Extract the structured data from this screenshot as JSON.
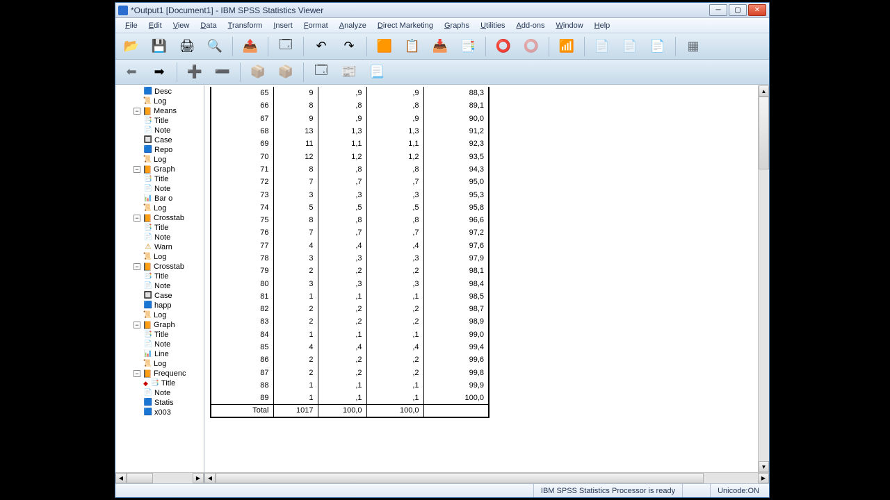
{
  "title": "*Output1 [Document1] - IBM SPSS Statistics Viewer",
  "menu": [
    "File",
    "Edit",
    "View",
    "Data",
    "Transform",
    "Insert",
    "Format",
    "Analyze",
    "Direct Marketing",
    "Graphs",
    "Utilities",
    "Add-ons",
    "Window",
    "Help"
  ],
  "outline": [
    {
      "ind": 3,
      "icon": "table",
      "label": "Desc"
    },
    {
      "ind": 2,
      "icon": "log",
      "label": "Log"
    },
    {
      "ind": 2,
      "icon": "book",
      "label": "Means",
      "exp": "−"
    },
    {
      "ind": 3,
      "icon": "title",
      "label": "Title"
    },
    {
      "ind": 3,
      "icon": "note",
      "label": "Note"
    },
    {
      "ind": 3,
      "icon": "case",
      "label": "Case"
    },
    {
      "ind": 3,
      "icon": "table",
      "label": "Repo"
    },
    {
      "ind": 2,
      "icon": "log",
      "label": "Log"
    },
    {
      "ind": 2,
      "icon": "book",
      "label": "Graph",
      "exp": "−"
    },
    {
      "ind": 3,
      "icon": "title",
      "label": "Title"
    },
    {
      "ind": 3,
      "icon": "note",
      "label": "Note"
    },
    {
      "ind": 3,
      "icon": "chart",
      "label": "Bar o"
    },
    {
      "ind": 2,
      "icon": "log",
      "label": "Log"
    },
    {
      "ind": 2,
      "icon": "book",
      "label": "Crosstab",
      "exp": "−"
    },
    {
      "ind": 3,
      "icon": "title",
      "label": "Title"
    },
    {
      "ind": 3,
      "icon": "note",
      "label": "Note"
    },
    {
      "ind": 3,
      "icon": "warn",
      "label": "Warn"
    },
    {
      "ind": 2,
      "icon": "log",
      "label": "Log"
    },
    {
      "ind": 2,
      "icon": "book",
      "label": "Crosstab",
      "exp": "−"
    },
    {
      "ind": 3,
      "icon": "title",
      "label": "Title"
    },
    {
      "ind": 3,
      "icon": "note",
      "label": "Note"
    },
    {
      "ind": 3,
      "icon": "case",
      "label": "Case"
    },
    {
      "ind": 3,
      "icon": "table",
      "label": "happ"
    },
    {
      "ind": 2,
      "icon": "log",
      "label": "Log"
    },
    {
      "ind": 2,
      "icon": "book",
      "label": "Graph",
      "exp": "−"
    },
    {
      "ind": 3,
      "icon": "title",
      "label": "Title"
    },
    {
      "ind": 3,
      "icon": "note",
      "label": "Note"
    },
    {
      "ind": 3,
      "icon": "chart",
      "label": "Line"
    },
    {
      "ind": 2,
      "icon": "log",
      "label": "Log"
    },
    {
      "ind": 2,
      "icon": "book",
      "label": "Frequenc",
      "exp": "−"
    },
    {
      "ind": 3,
      "icon": "title",
      "label": "Title",
      "active": true
    },
    {
      "ind": 3,
      "icon": "note",
      "label": "Note"
    },
    {
      "ind": 3,
      "icon": "table",
      "label": "Statis"
    },
    {
      "ind": 3,
      "icon": "table",
      "label": "x003"
    }
  ],
  "table": {
    "rows": [
      {
        "c0": "65",
        "c1": "9",
        "c2": ",9",
        "c3": ",9",
        "c4": "88,3"
      },
      {
        "c0": "66",
        "c1": "8",
        "c2": ",8",
        "c3": ",8",
        "c4": "89,1"
      },
      {
        "c0": "67",
        "c1": "9",
        "c2": ",9",
        "c3": ",9",
        "c4": "90,0"
      },
      {
        "c0": "68",
        "c1": "13",
        "c2": "1,3",
        "c3": "1,3",
        "c4": "91,2"
      },
      {
        "c0": "69",
        "c1": "11",
        "c2": "1,1",
        "c3": "1,1",
        "c4": "92,3"
      },
      {
        "c0": "70",
        "c1": "12",
        "c2": "1,2",
        "c3": "1,2",
        "c4": "93,5"
      },
      {
        "c0": "71",
        "c1": "8",
        "c2": ",8",
        "c3": ",8",
        "c4": "94,3"
      },
      {
        "c0": "72",
        "c1": "7",
        "c2": ",7",
        "c3": ",7",
        "c4": "95,0"
      },
      {
        "c0": "73",
        "c1": "3",
        "c2": ",3",
        "c3": ",3",
        "c4": "95,3"
      },
      {
        "c0": "74",
        "c1": "5",
        "c2": ",5",
        "c3": ",5",
        "c4": "95,8"
      },
      {
        "c0": "75",
        "c1": "8",
        "c2": ",8",
        "c3": ",8",
        "c4": "96,6"
      },
      {
        "c0": "76",
        "c1": "7",
        "c2": ",7",
        "c3": ",7",
        "c4": "97,2"
      },
      {
        "c0": "77",
        "c1": "4",
        "c2": ",4",
        "c3": ",4",
        "c4": "97,6"
      },
      {
        "c0": "78",
        "c1": "3",
        "c2": ",3",
        "c3": ",3",
        "c4": "97,9"
      },
      {
        "c0": "79",
        "c1": "2",
        "c2": ",2",
        "c3": ",2",
        "c4": "98,1"
      },
      {
        "c0": "80",
        "c1": "3",
        "c2": ",3",
        "c3": ",3",
        "c4": "98,4"
      },
      {
        "c0": "81",
        "c1": "1",
        "c2": ",1",
        "c3": ",1",
        "c4": "98,5"
      },
      {
        "c0": "82",
        "c1": "2",
        "c2": ",2",
        "c3": ",2",
        "c4": "98,7"
      },
      {
        "c0": "83",
        "c1": "2",
        "c2": ",2",
        "c3": ",2",
        "c4": "98,9"
      },
      {
        "c0": "84",
        "c1": "1",
        "c2": ",1",
        "c3": ",1",
        "c4": "99,0"
      },
      {
        "c0": "85",
        "c1": "4",
        "c2": ",4",
        "c3": ",4",
        "c4": "99,4"
      },
      {
        "c0": "86",
        "c1": "2",
        "c2": ",2",
        "c3": ",2",
        "c4": "99,6"
      },
      {
        "c0": "87",
        "c1": "2",
        "c2": ",2",
        "c3": ",2",
        "c4": "99,8"
      },
      {
        "c0": "88",
        "c1": "1",
        "c2": ",1",
        "c3": ",1",
        "c4": "99,9"
      },
      {
        "c0": "89",
        "c1": "1",
        "c2": ",1",
        "c3": ",1",
        "c4": "100,0"
      }
    ],
    "total": {
      "c0": "Total",
      "c1": "1017",
      "c2": "100,0",
      "c3": "100,0",
      "c4": ""
    }
  },
  "status": {
    "proc": "IBM SPSS Statistics Processor is ready",
    "unicode": "Unicode:ON"
  }
}
